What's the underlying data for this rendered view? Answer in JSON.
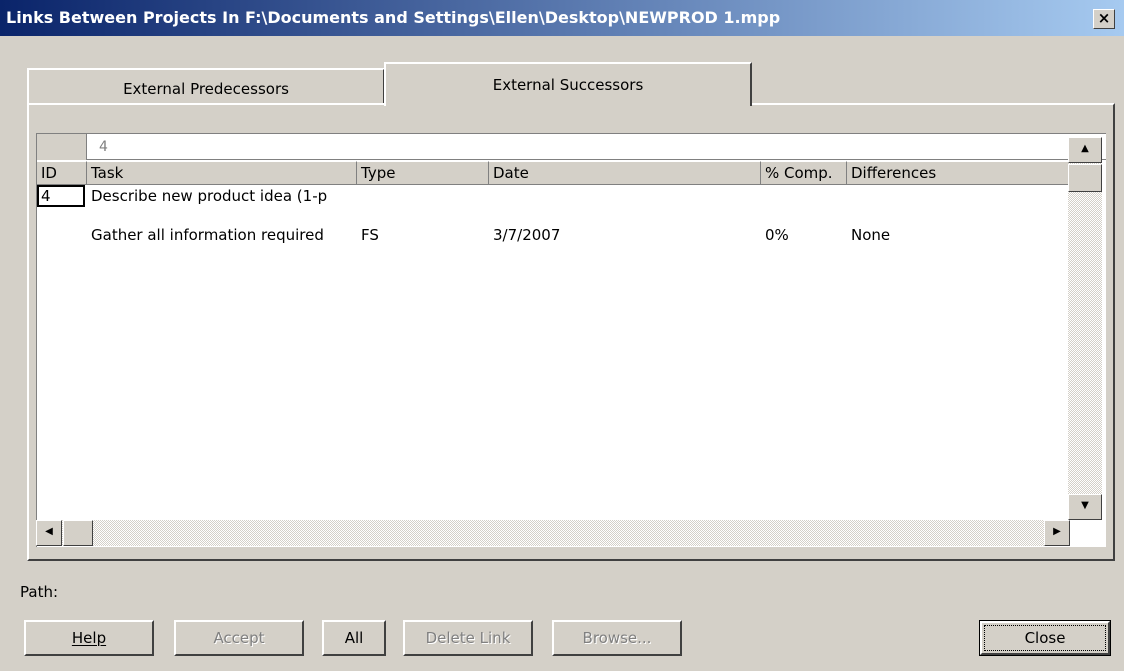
{
  "window": {
    "title": "Links Between Projects In F:\\Documents and Settings\\Ellen\\Desktop\\NEWPROD 1.mpp",
    "close_glyph": "×"
  },
  "tabs": [
    {
      "label": "External Predecessors",
      "active": false
    },
    {
      "label": "External Successors",
      "active": true
    }
  ],
  "grid": {
    "entry_value": "4",
    "columns": [
      "ID",
      "Task",
      "Type",
      "Date",
      "% Comp.",
      "Differences"
    ],
    "rows": [
      {
        "id": "4",
        "task": "Describe new product idea (1-p",
        "type": "",
        "date": "",
        "comp": "",
        "differences": ""
      },
      {
        "id": "",
        "task": "Gather all information required",
        "type": "FS",
        "date": "3/7/2007",
        "comp": "0%",
        "differences": "None"
      }
    ]
  },
  "scroll": {
    "up": "▲",
    "down": "▼",
    "left": "◀",
    "right": "▶"
  },
  "path": {
    "label": "Path:"
  },
  "buttons": {
    "help": "Help",
    "accept": "Accept",
    "all": "All",
    "delete_link": "Delete Link",
    "browse": "Browse...",
    "close": "Close"
  }
}
